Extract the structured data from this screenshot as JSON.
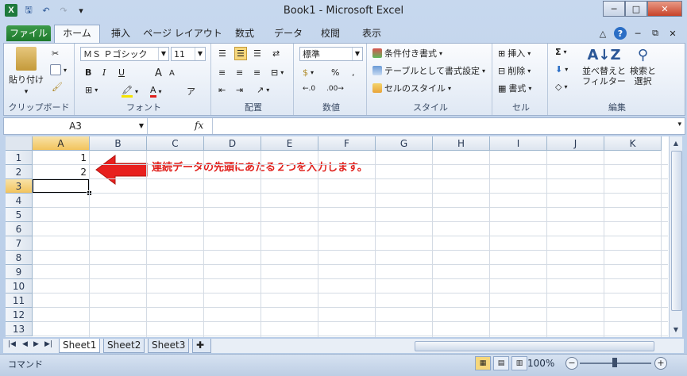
{
  "titlebar": {
    "title": "Book1 - Microsoft Excel",
    "minimize": "─",
    "maximize": "□",
    "close": "✕"
  },
  "qat": {
    "save": "🖫",
    "undo": "↶",
    "redo": "↷",
    "customize": "▾"
  },
  "tabs": [
    "ファイル",
    "ホーム",
    "挿入",
    "ページ レイアウト",
    "数式",
    "データ",
    "校閲",
    "表示"
  ],
  "ribbon": {
    "clipboard": {
      "label": "クリップボード",
      "paste": "貼り付け",
      "paste_arrow": "▾"
    },
    "font": {
      "label": "フォント",
      "name": "ＭＳ Ｐゴシック",
      "size": "11",
      "bold": "B",
      "italic": "I",
      "underline": "U",
      "grow": "A",
      "shrink": "A",
      "phonetic": "ア"
    },
    "alignment": {
      "label": "配置"
    },
    "number": {
      "label": "数値",
      "format": "標準",
      "percent": "%",
      "comma": ","
    },
    "styles": {
      "label": "スタイル",
      "conditional": "条件付き書式",
      "table": "テーブルとして書式設定",
      "cell_styles": "セルのスタイル"
    },
    "cells": {
      "label": "セル",
      "insert": "挿入",
      "delete": "削除",
      "format": "書式"
    },
    "editing": {
      "label": "編集",
      "sum": "Σ",
      "sort_filter": "並べ替えと\nフィルター",
      "find_select": "検索と\n選択"
    }
  },
  "formula_bar": {
    "name_box": "A3",
    "fx": "fx",
    "value": ""
  },
  "grid": {
    "columns": [
      "A",
      "B",
      "C",
      "D",
      "E",
      "F",
      "G",
      "H",
      "I",
      "J",
      "K"
    ],
    "rows": [
      "1",
      "2",
      "3",
      "4",
      "5",
      "6",
      "7",
      "8",
      "9",
      "10",
      "11",
      "12",
      "13"
    ],
    "selected_column": "A",
    "selected_row": "3",
    "cells": {
      "A1": "1",
      "A2": "2"
    }
  },
  "annotation": "連続データの先頭にあたる２つを入力します。",
  "sheets": [
    "Sheet1",
    "Sheet2",
    "Sheet3"
  ],
  "active_sheet": "Sheet1",
  "status": {
    "mode": "コマンド",
    "zoom": "100%",
    "zoom_out": "−",
    "zoom_in": "+"
  },
  "colors": {
    "annotation": "#e0201c",
    "arrow": "#e8201e",
    "selection_header": "#f2c35d",
    "file_tab": "#2a8a3a"
  }
}
